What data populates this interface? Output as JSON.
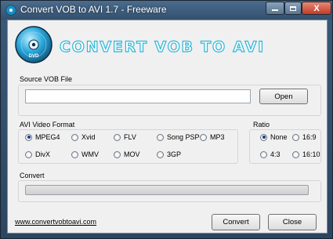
{
  "window": {
    "title": "Convert VOB to AVI 1.7 - Freeware",
    "close_glyph": "X"
  },
  "header": {
    "app_name": "CONVERT VOB TO AVI",
    "disc_label": "DVD"
  },
  "source": {
    "label": "Source VOB File",
    "value": "",
    "open_label": "Open"
  },
  "format": {
    "label": "AVI Video Format",
    "options": [
      "MPEG4",
      "Xvid",
      "FLV",
      "Song PSP",
      "MP3",
      "DivX",
      "WMV",
      "MOV",
      "3GP"
    ],
    "selected": "MPEG4"
  },
  "ratio": {
    "label": "Ratio",
    "options": [
      "None",
      "16:9",
      "4:3",
      "16:10"
    ],
    "selected": "None"
  },
  "convert": {
    "label": "Convert",
    "progress": 0
  },
  "footer": {
    "link": "www.convertvobtoavi.com",
    "convert_label": "Convert",
    "close_label": "Close"
  },
  "colors": {
    "heading_outline": "#2bb7d8",
    "titlebar": "#3a5a7a",
    "close_button": "#c23a22"
  }
}
